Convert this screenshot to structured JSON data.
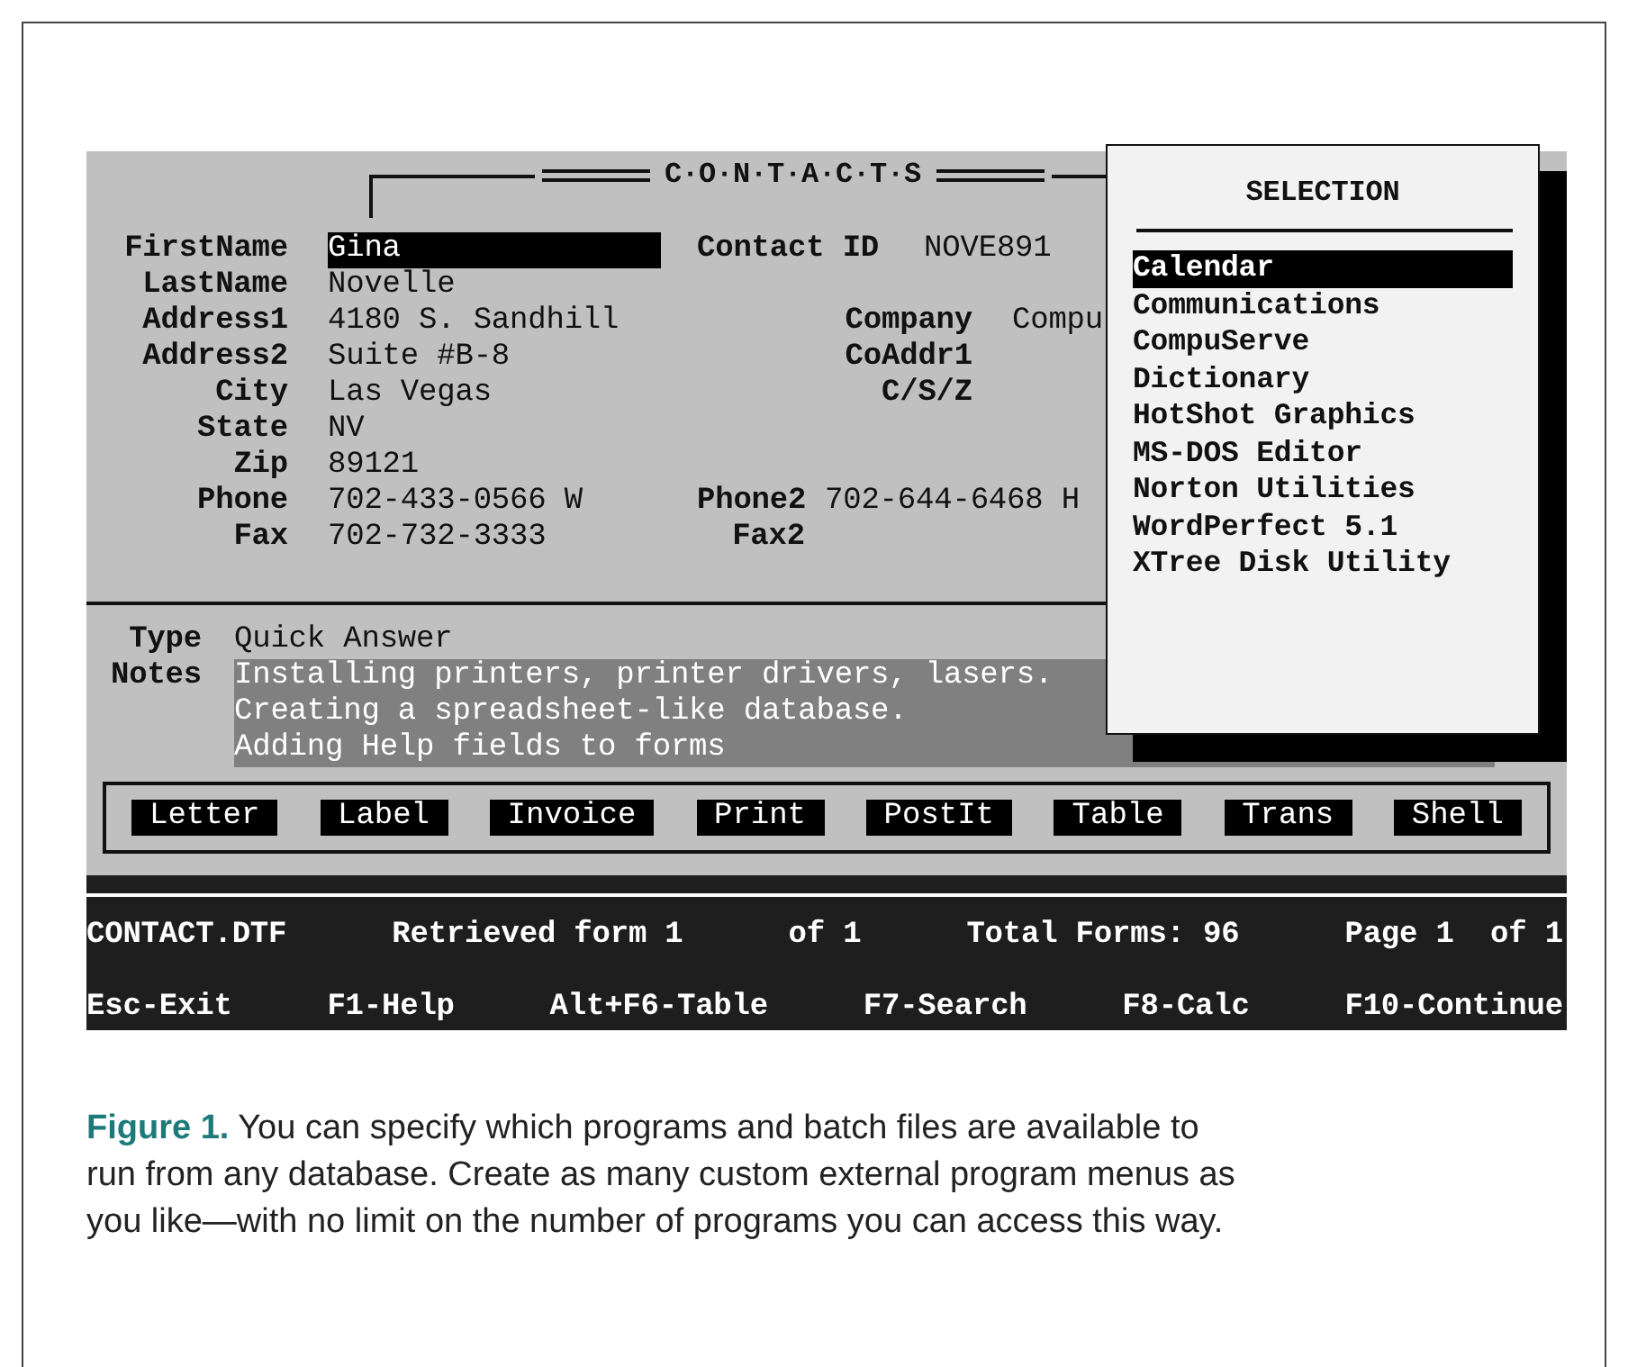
{
  "screen_title": "C·O·N·T·A·C·T·S",
  "contact_id": {
    "label": "Contact ID",
    "value": "NOVE891"
  },
  "fields": [
    {
      "label": "FirstName",
      "value": "Gina",
      "selected": true
    },
    {
      "label": "LastName",
      "value": "Novelle",
      "selected": false
    },
    {
      "label": "Address1",
      "value": "4180 S. Sandhill",
      "selected": false
    },
    {
      "label": "Address2",
      "value": "Suite #B-8",
      "selected": false
    },
    {
      "label": "City",
      "value": "Las Vegas",
      "selected": false
    },
    {
      "label": "State",
      "value": "NV",
      "selected": false
    },
    {
      "label": "Zip",
      "value": "89121",
      "selected": false
    },
    {
      "label": "Phone",
      "value": "702-433-0566 W",
      "selected": false
    },
    {
      "label": "Fax",
      "value": "702-732-3333",
      "selected": false
    }
  ],
  "company_fields": [
    {
      "label": "Company",
      "value": "Compu"
    },
    {
      "label": "CoAddr1"
    },
    {
      "label": "C/S/Z"
    }
  ],
  "phone_fields": [
    {
      "label": "Phone2",
      "value": "702-644-6468 H"
    },
    {
      "label": "Fax2"
    }
  ],
  "type_field": {
    "label": "Type",
    "value": "Quick Answer"
  },
  "notes": {
    "label": "Notes",
    "lines": [
      "Installing printers, printer drivers, lasers.",
      "Creating a spreadsheet-like database.",
      "Adding Help fields to forms"
    ]
  },
  "buttons": [
    "Letter",
    "Label",
    "Invoice",
    "Print",
    "PostIt",
    "Table",
    "Trans",
    "Shell"
  ],
  "status_bar": [
    "CONTACT.DTF",
    "Retrieved form 1",
    "of 1",
    "Total Forms: 96",
    "Page 1  of 1"
  ],
  "function_keys": [
    "Esc-Exit",
    "F1-Help",
    "Alt+F6-Table",
    "F7-Search",
    "F8-Calc",
    "F10-Continue"
  ],
  "selection_menu": {
    "title": "SELECTION",
    "items": [
      {
        "label": "Calendar",
        "selected": true
      },
      {
        "label": "Communications",
        "selected": false
      },
      {
        "label": "CompuServe",
        "selected": false
      },
      {
        "label": "Dictionary",
        "selected": false
      },
      {
        "label": "HotShot Graphics",
        "selected": false
      },
      {
        "label": "MS-DOS Editor",
        "selected": false
      },
      {
        "label": "Norton Utilities",
        "selected": false
      },
      {
        "label": "WordPerfect 5.1",
        "selected": false
      },
      {
        "label": "XTree Disk Utility",
        "selected": false
      }
    ]
  },
  "caption": "**Figure 1.** You can specify which programs and batch files are available to run from any database. Create as many custom external program menus as you like—with no limit on the number of programs you can access this way."
}
